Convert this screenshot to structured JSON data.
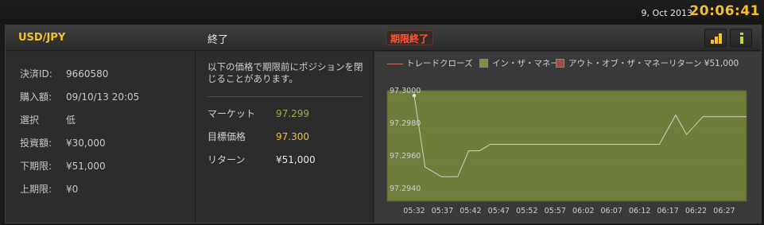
{
  "topbar": {
    "date": "9, Oct 2013",
    "time": "20:06:41"
  },
  "header": {
    "pair": "USD/JPY",
    "state": "終了",
    "badge": "期限終了",
    "stats_icon": "bar-chart-icon",
    "info_icon": "info-icon"
  },
  "details": {
    "rows": [
      {
        "label": "決済ID:",
        "value": "9660580"
      },
      {
        "label": "購入額:",
        "value": "09/10/13 20:05"
      },
      {
        "label": "選択",
        "value": "低"
      },
      {
        "label": "投資額:",
        "value": "¥30,000"
      },
      {
        "label": "下期限:",
        "value": "¥51,000"
      },
      {
        "label": "上期限:",
        "value": "¥0"
      }
    ]
  },
  "summary": {
    "note": "以下の価格で期限前にポジションを閉じることがあります。",
    "items": [
      {
        "label": "マーケット",
        "value": "97.299"
      },
      {
        "label": "目標価格",
        "value": "97.300"
      },
      {
        "label": "リターン",
        "value": "¥51,000"
      }
    ]
  },
  "colors": {
    "accent_gold": "#f2c12e",
    "badge_red": "#ff5a3a",
    "plot_green": "#6f7d3a",
    "market_green": "#9bb04a",
    "trade_close_line": "#c8746a"
  },
  "chart_data": {
    "type": "line",
    "legend": {
      "trade_close": "トレードクローズ",
      "in_the_money": "イン・ザ・マネー",
      "out_of_money": "アウト・オブ・ザ・マネー",
      "return_text": "リターン ¥51,000"
    },
    "x_ticks": [
      "05:32",
      "05:37",
      "05:42",
      "05:47",
      "05:52",
      "05:57",
      "06:02",
      "06:07",
      "06:12",
      "06:17",
      "06:22",
      "06:27"
    ],
    "y_ticks": [
      "97.3000",
      "97.2980",
      "97.2960",
      "97.2940"
    ],
    "ylim": [
      97.2935,
      97.3003
    ],
    "xlim_minutes": [
      0,
      61
    ],
    "series": [
      {
        "x_minutes": [
          0,
          2,
          5,
          8,
          10,
          12,
          14,
          19,
          45,
          48,
          50,
          53,
          61
        ],
        "values": [
          97.3,
          97.2956,
          97.295,
          97.295,
          97.2966,
          97.2966,
          97.297,
          97.297,
          97.297,
          97.2988,
          97.2976,
          97.2987,
          97.2987
        ]
      }
    ],
    "region": "in_the_money"
  }
}
